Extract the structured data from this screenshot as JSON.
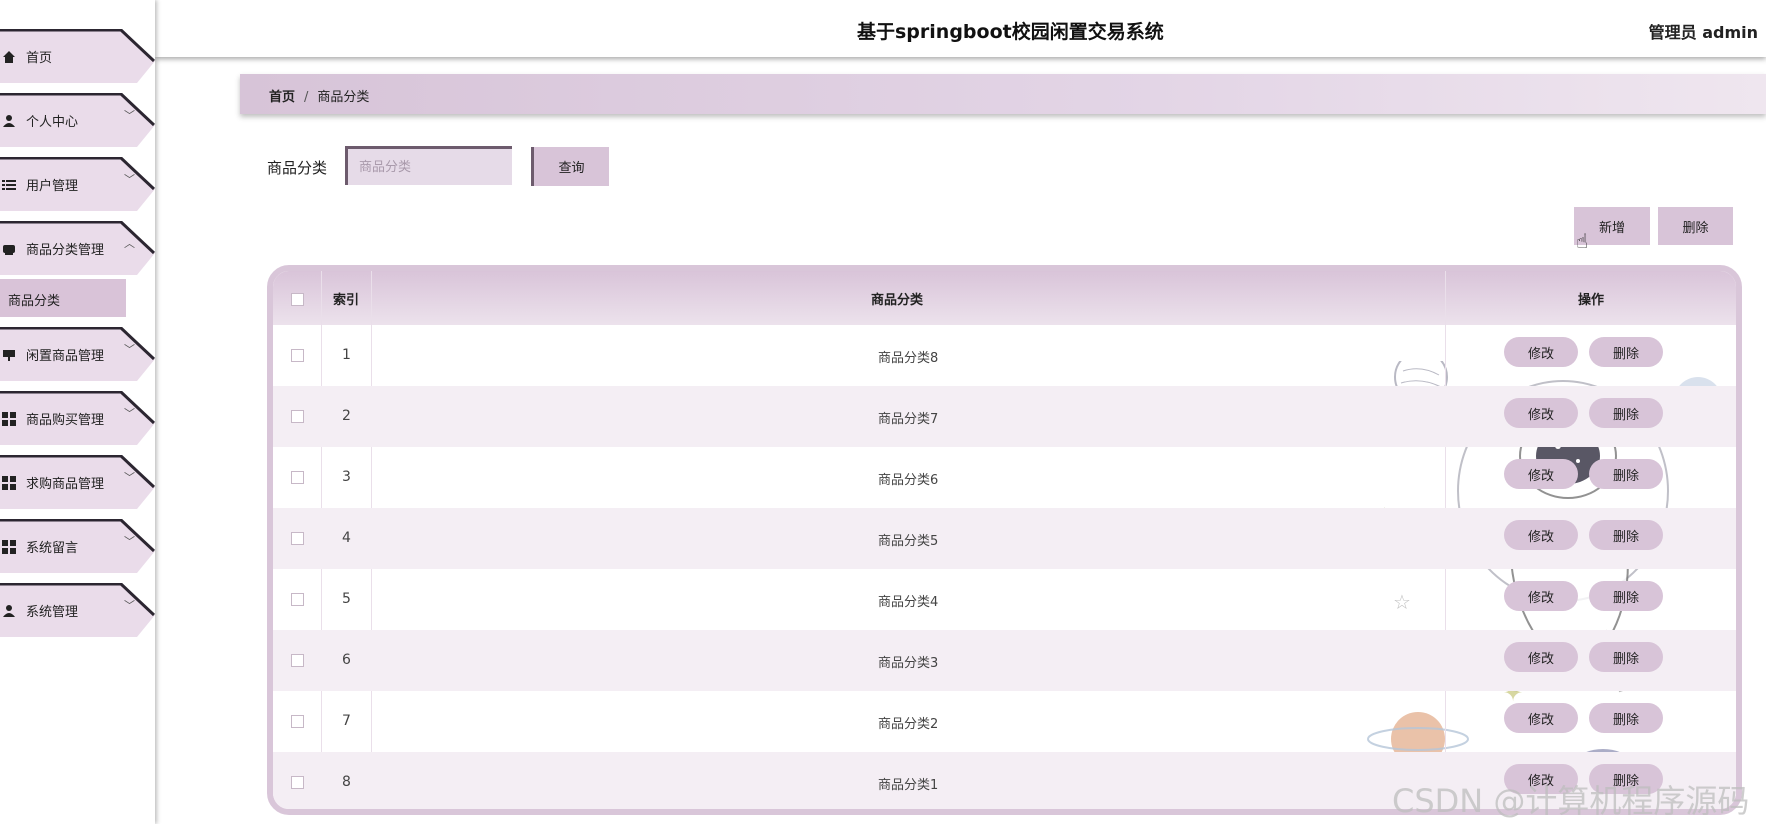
{
  "header": {
    "title": "基于springboot校园闲置交易系统",
    "user": "管理员 admin"
  },
  "sidebar": {
    "items": [
      {
        "label": "首页",
        "icon": "home-icon",
        "has_chevron": false
      },
      {
        "label": "个人中心",
        "icon": "person-icon",
        "has_chevron": true
      },
      {
        "label": "用户管理",
        "icon": "list-icon",
        "has_chevron": true
      },
      {
        "label": "商品分类管理",
        "icon": "box-icon",
        "has_chevron": true,
        "expanded": true
      },
      {
        "label": "闲置商品管理",
        "icon": "stand-icon",
        "has_chevron": true
      },
      {
        "label": "商品购买管理",
        "icon": "grid-icon",
        "has_chevron": true
      },
      {
        "label": "求购商品管理",
        "icon": "grid-icon",
        "has_chevron": true
      },
      {
        "label": "系统留言",
        "icon": "grid-icon",
        "has_chevron": true
      },
      {
        "label": "系统管理",
        "icon": "person-icon",
        "has_chevron": true
      }
    ],
    "sub_item": "商品分类"
  },
  "breadcrumb": {
    "home": "首页",
    "separator": "/",
    "current": "商品分类"
  },
  "search": {
    "label": "商品分类",
    "placeholder": "商品分类",
    "button": "查询"
  },
  "actions": {
    "add": "新增",
    "delete": "删除"
  },
  "table": {
    "columns": [
      "索引",
      "商品分类",
      "操作"
    ],
    "rows": [
      {
        "index": "1",
        "category": "商品分类8"
      },
      {
        "index": "2",
        "category": "商品分类7"
      },
      {
        "index": "3",
        "category": "商品分类6"
      },
      {
        "index": "4",
        "category": "商品分类5"
      },
      {
        "index": "5",
        "category": "商品分类4"
      },
      {
        "index": "6",
        "category": "商品分类3"
      },
      {
        "index": "7",
        "category": "商品分类2"
      },
      {
        "index": "8",
        "category": "商品分类1"
      }
    ],
    "row_edit": "修改",
    "row_delete": "删除"
  },
  "watermark": "CSDN @计算机程序源码",
  "colors": {
    "accent": "#d8c4d8",
    "dark_border": "#6d5b6d",
    "row_alt": "#f4eef4"
  }
}
